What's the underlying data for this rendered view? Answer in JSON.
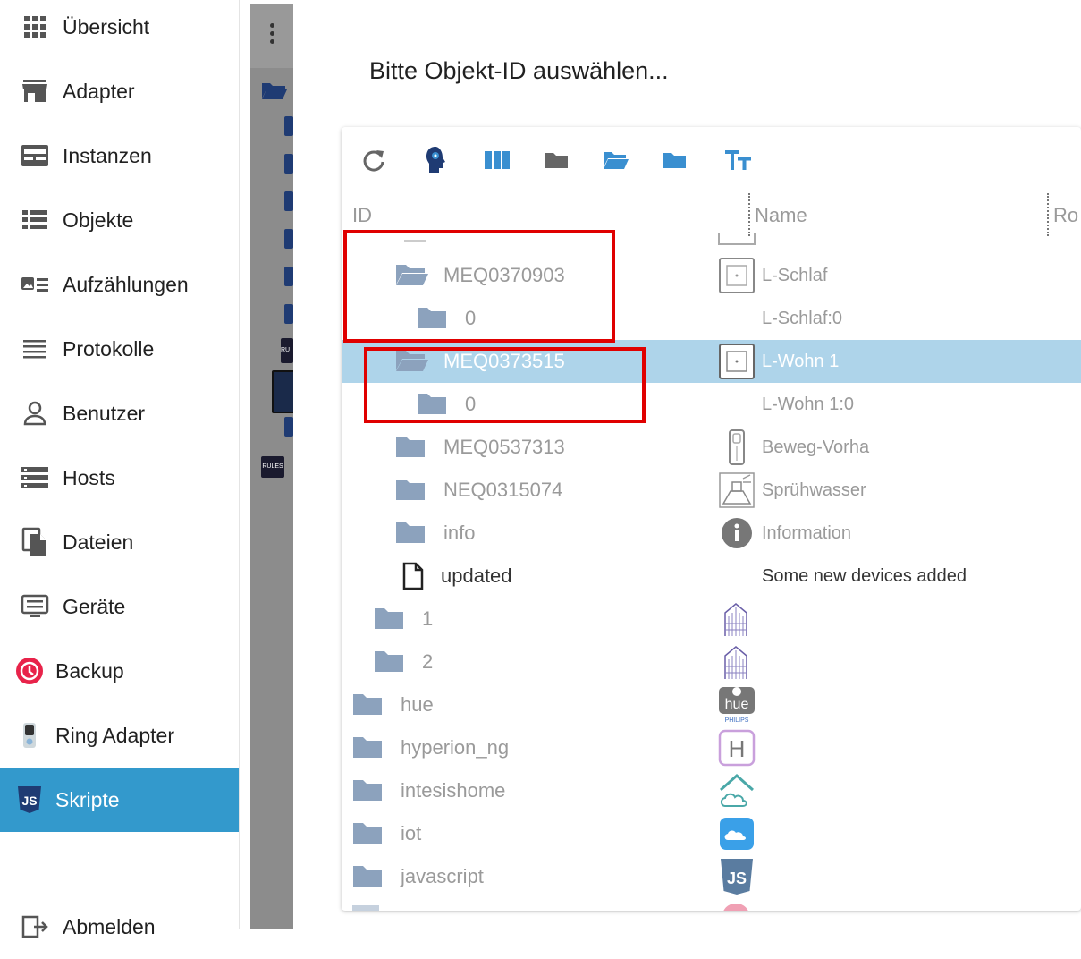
{
  "sidebar": {
    "items": [
      {
        "label": "Übersicht",
        "icon": "grid-icon"
      },
      {
        "label": "Adapter",
        "icon": "store-icon"
      },
      {
        "label": "Instanzen",
        "icon": "instances-icon"
      },
      {
        "label": "Objekte",
        "icon": "list-icon"
      },
      {
        "label": "Aufzählungen",
        "icon": "enum-icon"
      },
      {
        "label": "Protokolle",
        "icon": "log-icon"
      },
      {
        "label": "Benutzer",
        "icon": "user-icon"
      },
      {
        "label": "Hosts",
        "icon": "hosts-icon"
      },
      {
        "label": "Dateien",
        "icon": "files-icon"
      },
      {
        "label": "Geräte",
        "icon": "devices-icon"
      },
      {
        "label": "Backup",
        "icon": "backup-icon"
      },
      {
        "label": "Ring Adapter",
        "icon": "ring-icon"
      },
      {
        "label": "Skripte",
        "icon": "js-icon",
        "active": true
      }
    ],
    "logout_label": "Abmelden"
  },
  "strip": {
    "badges": [
      "RU",
      "RULES"
    ]
  },
  "dialog": {
    "title": "Bitte Objekt-ID auswählen...",
    "toolbar": [
      "refresh-icon",
      "expert-mode-icon",
      "columns-icon",
      "folder-closed-icon",
      "folder-open-icon",
      "folder-blue-icon",
      "text-size-icon"
    ],
    "columns": {
      "id": "ID",
      "name": "Name",
      "role": "Ro"
    },
    "rows": [
      {
        "id": "MEQ0370903",
        "name": "L-Schlaf",
        "type": "folder-open",
        "name_icon": "device-icon"
      },
      {
        "id": "0",
        "name": "L-Schlaf:0",
        "type": "folder"
      },
      {
        "id": "MEQ0373515",
        "name": "L-Wohn 1",
        "type": "folder-open",
        "name_icon": "device-icon",
        "selected": true
      },
      {
        "id": "0",
        "name": "L-Wohn 1:0",
        "type": "folder"
      },
      {
        "id": "MEQ0537313",
        "name": "Beweg-Vorha",
        "type": "folder",
        "name_icon": "motion-sensor-icon"
      },
      {
        "id": "NEQ0315074",
        "name": "Sprühwasser",
        "type": "folder",
        "name_icon": "sprinkler-icon"
      },
      {
        "id": "info",
        "name": "Information",
        "type": "folder",
        "name_icon": "info-icon"
      },
      {
        "id": "updated",
        "name": "Some new devices added",
        "type": "file"
      },
      {
        "id": "1",
        "name": "",
        "type": "folder",
        "name_icon": "homematic-icon"
      },
      {
        "id": "2",
        "name": "",
        "type": "folder",
        "name_icon": "homematic-icon"
      },
      {
        "id": "hue",
        "name": "",
        "type": "folder",
        "name_icon": "hue-icon",
        "icon_text": "hue",
        "icon_sub": "PHILIPS"
      },
      {
        "id": "hyperion_ng",
        "name": "",
        "type": "folder",
        "name_icon": "hyperion-icon",
        "icon_text": "H"
      },
      {
        "id": "intesishome",
        "name": "",
        "type": "folder",
        "name_icon": "intesis-icon"
      },
      {
        "id": "iot",
        "name": "",
        "type": "folder",
        "name_icon": "cloud-icon"
      },
      {
        "id": "javascript",
        "name": "",
        "type": "folder",
        "name_icon": "javascript-icon",
        "icon_text": "JS"
      }
    ]
  },
  "colors": {
    "accent": "#3399cc",
    "selected_row": "#aed4ea",
    "folder": "#8ca2bd",
    "folder_blue": "#3a8fd0",
    "highlight": "#e00000"
  }
}
